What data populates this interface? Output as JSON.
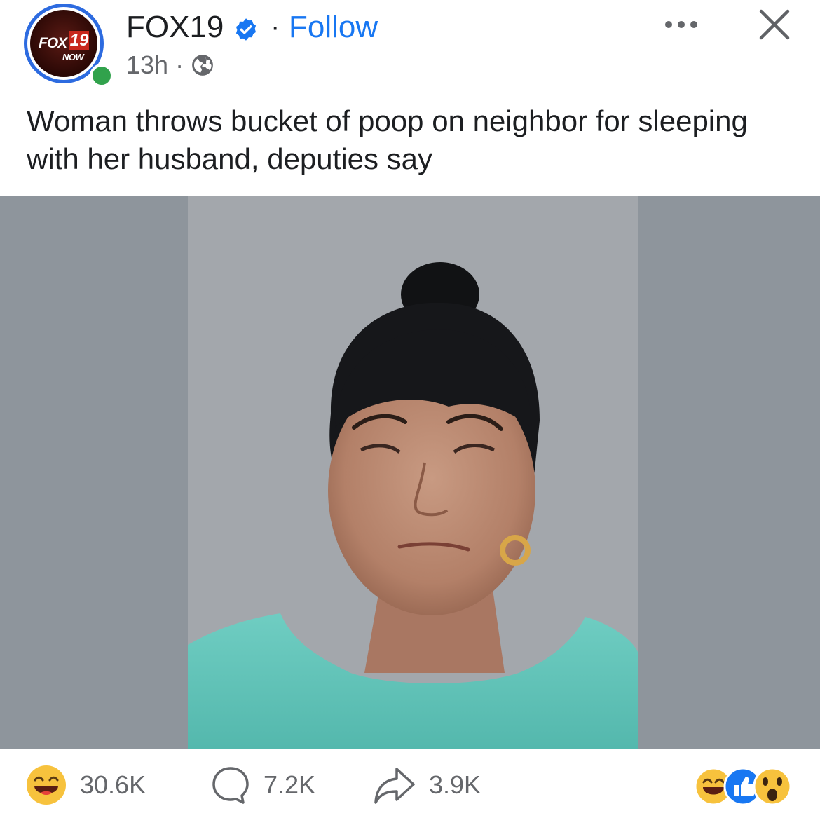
{
  "post": {
    "author": "FOX19",
    "separator": "·",
    "follow_label": "Follow",
    "time": "13h",
    "meta_separator": "·",
    "caption": "Woman throws bucket of poop on neighbor for sleeping with her husband, deputies say",
    "avatar_logo": {
      "fox": "FOX",
      "num": "19",
      "now": "NOW"
    }
  },
  "stats": {
    "reactions": "30.6K",
    "comments": "7.2K",
    "shares": "3.9K"
  },
  "icons": {
    "verified": "verified-badge-icon",
    "globe": "globe-icon",
    "more": "more-options-icon",
    "close": "close-icon",
    "reaction": "haha-reaction-icon",
    "comment": "comment-icon",
    "share": "share-icon",
    "reaction_summary": [
      "haha-reaction-icon",
      "like-reaction-icon",
      "wow-reaction-icon"
    ]
  },
  "colors": {
    "accent": "#1877f2",
    "secondary_text": "#65676b",
    "online": "#31a24c",
    "photo_background": "#a3a7ac"
  }
}
